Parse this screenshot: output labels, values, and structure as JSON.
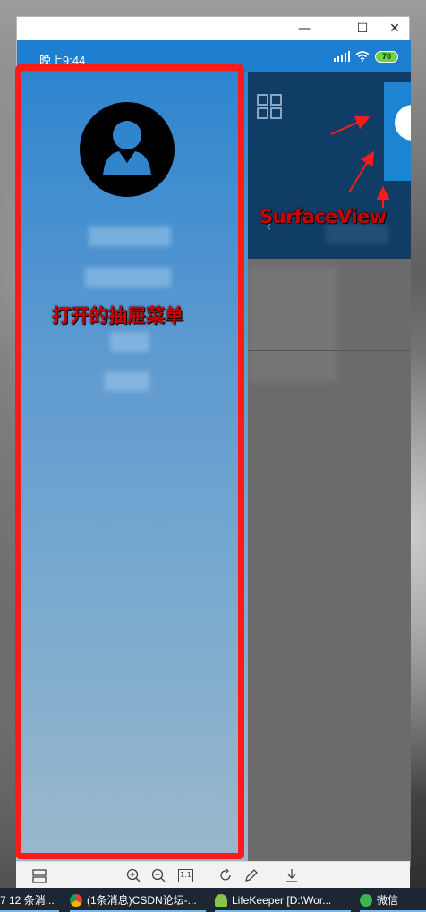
{
  "window": {
    "minimize_glyph": "—",
    "maximize_glyph": "☐",
    "close_glyph": "✕"
  },
  "status_bar": {
    "time": "晚上9:44",
    "battery": "70",
    "icons": [
      "signal-icon",
      "wifi-icon",
      "battery-icon"
    ],
    "color": "#1e7ed0"
  },
  "app_header": {
    "color": "#0f3d66",
    "icons": [
      "grid-icon",
      "back-chevron-icon"
    ]
  },
  "drawer": {
    "avatar_icon": "user-avatar-icon",
    "gradient_top": "#2e85cf",
    "gradient_bottom": "#9bb8cc"
  },
  "annotations": {
    "drawer_label": "打开的抽屉菜单",
    "surface_label": "SurfaceView",
    "color": "#ff1a1a"
  },
  "viewer_toolbar": {
    "icons": [
      "layout-icon",
      "zoom-in-icon",
      "zoom-out-icon",
      "actual-size-icon",
      "rotate-icon",
      "edit-icon",
      "download-icon"
    ],
    "actual_size_label": "1:1"
  },
  "taskbar": {
    "items": [
      {
        "label": "7 12 条消...",
        "icon": "chat-icon"
      },
      {
        "label": "(1条消息)CSDN论坛-...",
        "icon": "chrome-icon"
      },
      {
        "label": "LifeKeeper [D:\\Wor...",
        "icon": "android-icon"
      },
      {
        "label": "微信",
        "icon": "wechat-icon"
      }
    ]
  }
}
